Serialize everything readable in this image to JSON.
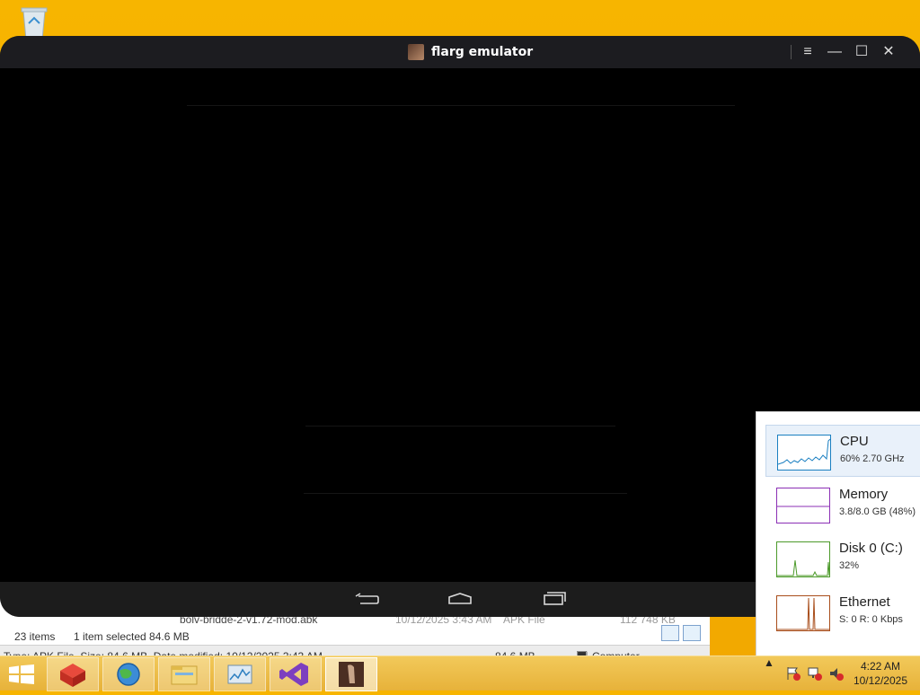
{
  "desktop": {
    "recycle_bin_icon": "recycle-bin-icon"
  },
  "explorer": {
    "file_row": {
      "name": "bolv-bridde-2-v1.72-mod.abk",
      "date": "10/12/2025 3:43 AM",
      "type": "APK File",
      "size": "112 748 KB"
    },
    "status_items": "23 items",
    "status_selected": "1 item selected  84.6 MB",
    "details_text": "Type: APK File, Size: 84.6 MB, Date modified: 10/12/2025 3:43 AM",
    "details_size": "84.6 MB",
    "details_location": "Computer"
  },
  "emulator": {
    "title": "flarg emulator",
    "controls": {
      "menu": "≡",
      "minimize": "—",
      "maximize": "☐",
      "close": "✕"
    }
  },
  "task_manager": {
    "tiles": [
      {
        "name": "CPU",
        "detail": "60%  2.70 GHz",
        "color": "#1a7fc1"
      },
      {
        "name": "Memory",
        "detail": "3.8/8.0 GB (48%)",
        "color": "#8b2fb5"
      },
      {
        "name": "Disk 0 (C:)",
        "detail": "32%",
        "color": "#4c9a2a"
      },
      {
        "name": "Ethernet",
        "detail": "S: 0  R: 0 Kbps",
        "color": "#a84d1a"
      }
    ]
  },
  "taskbar": {
    "clock_time": "4:22 AM",
    "clock_date": "10/12/2025",
    "tray_show_hidden": "▲"
  }
}
